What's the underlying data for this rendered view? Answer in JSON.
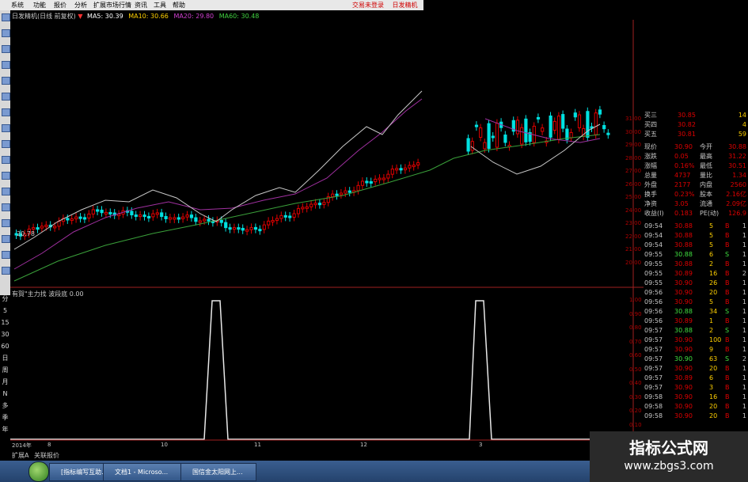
{
  "menu": {
    "items": [
      "系统",
      "功能",
      "报价",
      "分析",
      "扩展市场行情",
      "资讯",
      "工具",
      "帮助"
    ],
    "right_items": [
      "交易未登录",
      "日发精机"
    ]
  },
  "chart_header": {
    "title": "日发精机(日线 前复权)",
    "ma5": "MA5: 30.39",
    "ma10": "MA10: 30.66",
    "ma20": "MA20: 29.80",
    "ma60": "MA60: 30.48"
  },
  "indicator_header": {
    "text": "有賀\"主力找 波段底 0.00"
  },
  "price_marker": "20.78",
  "left_labels": [
    "分",
    "5",
    "15",
    "30",
    "60",
    "日",
    "周",
    "月",
    "N",
    "多",
    "季",
    "年"
  ],
  "price_axis": [
    "31.00",
    "30.00",
    "29.00",
    "28.00",
    "27.00",
    "26.00",
    "25.00",
    "24.00",
    "23.00",
    "22.00",
    "21.00",
    "20.00"
  ],
  "indicator_axis": [
    "1.00",
    "0.90",
    "0.80",
    "0.70",
    "0.60",
    "0.50",
    "0.40",
    "0.30",
    "0.20",
    "0.10"
  ],
  "date_axis": [
    "2014年",
    "8",
    "10",
    "11",
    "12",
    "3"
  ],
  "bottom_tabs": [
    "扩展A",
    "关联报价"
  ],
  "quote": {
    "asks": [
      {
        "label": "买三",
        "price": "30.85",
        "vol": "14"
      },
      {
        "label": "买四",
        "price": "30.82",
        "vol": "4"
      },
      {
        "label": "买五",
        "price": "30.81",
        "vol": "59"
      }
    ],
    "stats": [
      {
        "l1": "现价",
        "v1": "30.90",
        "l2": "今开",
        "v2": "30.88"
      },
      {
        "l1": "涨跌",
        "v1": "0.05",
        "l2": "最高",
        "v2": "31.22"
      },
      {
        "l1": "涨幅",
        "v1": "0.16%",
        "l2": "最低",
        "v2": "30.51"
      },
      {
        "l1": "总量",
        "v1": "4737",
        "l2": "量比",
        "v2": "1.34"
      },
      {
        "l1": "外盘",
        "v1": "2177",
        "l2": "内盘",
        "v2": "2560"
      },
      {
        "l1": "换手",
        "v1": "0.23%",
        "l2": "股本",
        "v2": "2.16亿"
      },
      {
        "l1": "净资",
        "v1": "3.05",
        "l2": "流通",
        "v2": "2.09亿"
      },
      {
        "l1": "收益(I)",
        "v1": "0.183",
        "l2": "PE(动)",
        "v2": "126.9"
      }
    ],
    "trades": [
      {
        "t": "09:54",
        "p": "30.88",
        "v": "5",
        "s": "B",
        "n": "1"
      },
      {
        "t": "09:54",
        "p": "30.88",
        "v": "5",
        "s": "B",
        "n": "1"
      },
      {
        "t": "09:54",
        "p": "30.88",
        "v": "5",
        "s": "B",
        "n": "1"
      },
      {
        "t": "09:55",
        "p": "30.88",
        "v": "6",
        "s": "S",
        "n": "1"
      },
      {
        "t": "09:55",
        "p": "30.88",
        "v": "2",
        "s": "B",
        "n": "1"
      },
      {
        "t": "09:55",
        "p": "30.89",
        "v": "16",
        "s": "B",
        "n": "2"
      },
      {
        "t": "09:55",
        "p": "30.90",
        "v": "26",
        "s": "B",
        "n": "1"
      },
      {
        "t": "09:56",
        "p": "30.90",
        "v": "20",
        "s": "B",
        "n": "1"
      },
      {
        "t": "09:56",
        "p": "30.90",
        "v": "5",
        "s": "B",
        "n": "1"
      },
      {
        "t": "09:56",
        "p": "30.88",
        "v": "34",
        "s": "S",
        "n": "1"
      },
      {
        "t": "09:56",
        "p": "30.89",
        "v": "1",
        "s": "B",
        "n": "1"
      },
      {
        "t": "09:57",
        "p": "30.88",
        "v": "2",
        "s": "S",
        "n": "1"
      },
      {
        "t": "09:57",
        "p": "30.90",
        "v": "100",
        "s": "B",
        "n": "1"
      },
      {
        "t": "09:57",
        "p": "30.90",
        "v": "9",
        "s": "B",
        "n": "1"
      },
      {
        "t": "09:57",
        "p": "30.90",
        "v": "63",
        "s": "S",
        "n": "2"
      },
      {
        "t": "09:57",
        "p": "30.90",
        "v": "20",
        "s": "B",
        "n": "1"
      },
      {
        "t": "09:57",
        "p": "30.89",
        "v": "6",
        "s": "B",
        "n": "1"
      },
      {
        "t": "09:57",
        "p": "30.90",
        "v": "3",
        "s": "B",
        "n": "1"
      },
      {
        "t": "09:58",
        "p": "30.90",
        "v": "16",
        "s": "B",
        "n": "1"
      },
      {
        "t": "09:58",
        "p": "30.90",
        "v": "20",
        "s": "B",
        "n": "1"
      },
      {
        "t": "09:58",
        "p": "30.90",
        "v": "20",
        "s": "B",
        "n": "1"
      }
    ]
  },
  "taskbar": {
    "items": [
      "[指标编写互助...",
      "文档1 - Microso...",
      "国信金太阳网上..."
    ]
  },
  "watermark": {
    "title": "指标公式网",
    "url": "www.zbgs3.com"
  },
  "colors": {
    "up": "#e00000",
    "down": "#00e0e0",
    "accent": "#ff3030"
  }
}
